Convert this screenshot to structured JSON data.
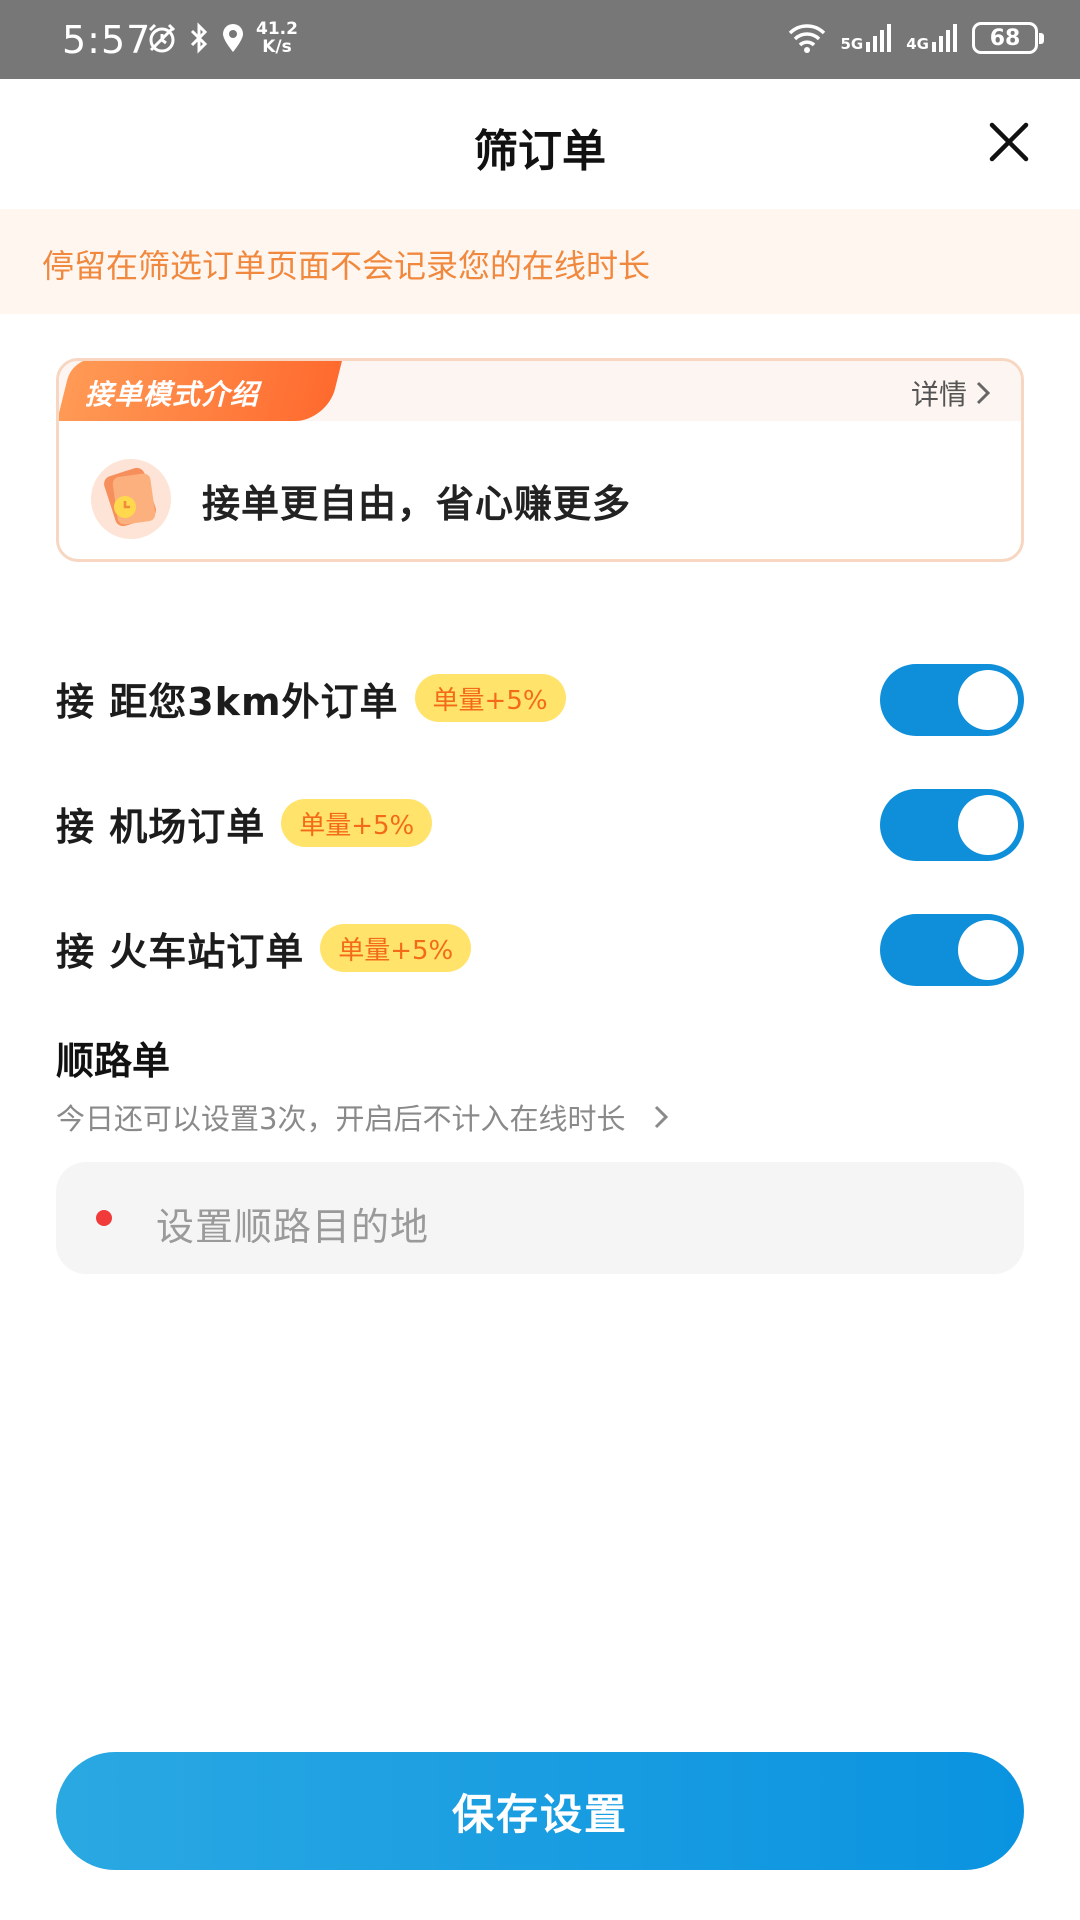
{
  "status_bar": {
    "time": "5:57",
    "speed": "41.2",
    "speed_unit": "K/s",
    "net1": "5G",
    "net2": "4G",
    "battery": "68"
  },
  "header": {
    "title": "筛订单"
  },
  "notice": {
    "text": "停留在筛选订单页面不会记录您的在线时长"
  },
  "intro_card": {
    "tag": "接单模式介绍",
    "detail": "详情",
    "slogan": "接单更自由，省心赚更多"
  },
  "toggles": [
    {
      "label": "接 距您3km外订单",
      "badge": "单量+5%",
      "on": true
    },
    {
      "label": "接 机场订单",
      "badge": "单量+5%",
      "on": true
    },
    {
      "label": "接 火车站订单",
      "badge": "单量+5%",
      "on": true
    }
  ],
  "route": {
    "title": "顺路单",
    "subtitle": "今日还可以设置3次，开启后不计入在线时长",
    "placeholder": "设置顺路目的地"
  },
  "save_button": "保存设置",
  "colors": {
    "accent_blue": "#0f8fd9",
    "notice_text": "#f0883e",
    "badge_bg": "#ffe36b",
    "badge_text": "#f36b18"
  }
}
